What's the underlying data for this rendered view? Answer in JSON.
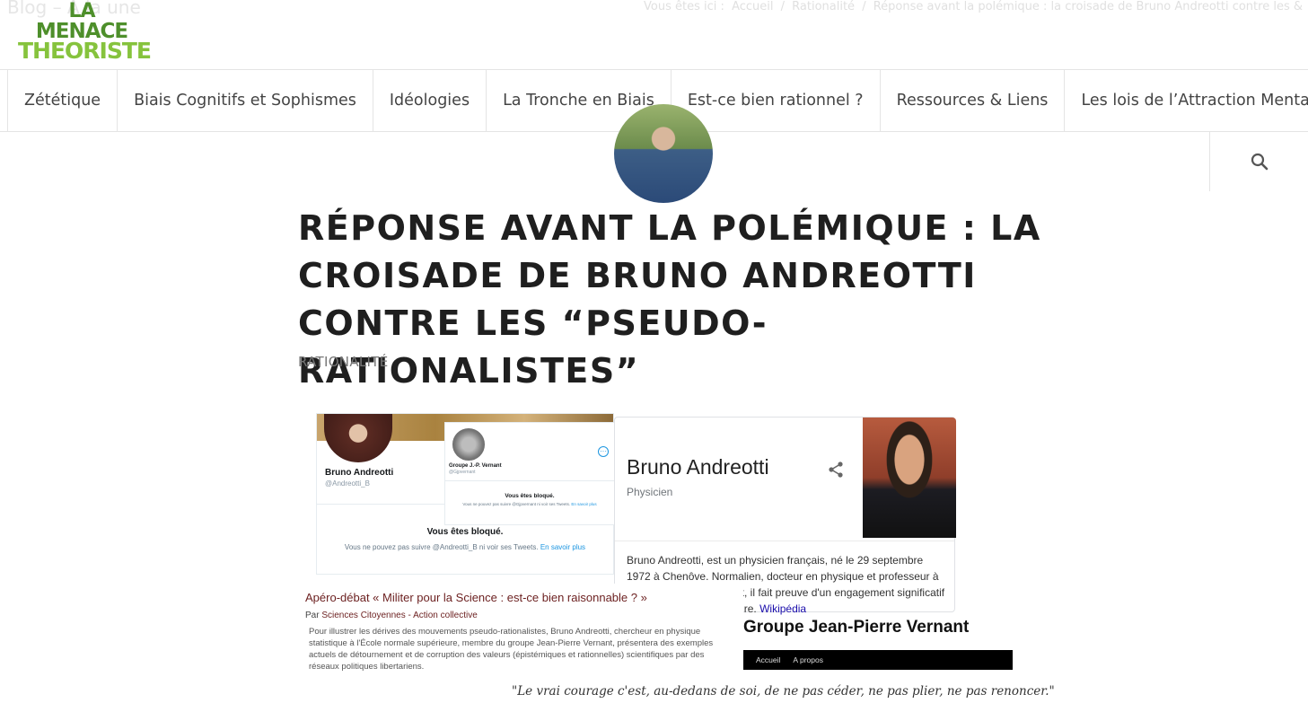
{
  "header": {
    "ghost_title": "Blog – A la une",
    "breadcrumb": {
      "prefix": "Vous êtes ici :",
      "home": "Accueil",
      "sep1": "/",
      "category": "Rationalité",
      "sep2": "/",
      "current": "Réponse avant la polémique : la croisade de Bruno Andreotti contre les &"
    },
    "logo": {
      "line1": "LA",
      "line2": "MENACE",
      "line3": "THEORISTE"
    }
  },
  "nav": {
    "items": [
      {
        "label": "Zététique"
      },
      {
        "label": "Biais Cognitifs et Sophismes"
      },
      {
        "label": "Idéologies"
      },
      {
        "label": "La Tronche en Biais"
      },
      {
        "label": "Est-ce bien rationnel ?"
      },
      {
        "label": "Ressources & Liens"
      },
      {
        "label": "Les lois de l’Attraction Mentale"
      }
    ],
    "search_icon": "search-icon"
  },
  "article": {
    "title": "Réponse avant la polémique : la croisade de Bruno Andreotti contre les “pseudo-rationalistes”",
    "category": "RATIONALITÉ"
  },
  "collage": {
    "tweet1": {
      "name": "Bruno Andreotti",
      "handle": "@Andreotti_B",
      "blocked": "Vous êtes bloqué.",
      "msg": "Vous ne pouvez pas suivre @Andreotti_B ni voir ses Tweets.",
      "link": "En savoir plus"
    },
    "tweet2": {
      "name": "Groupe J.-P. Vernant",
      "handle": "@Gjpvernant",
      "blocked": "Vous êtes bloqué.",
      "msg": "Vous ne pouvez pas suivre @Gjpvernant ni voir ses Tweets.",
      "link": "En savoir plus"
    },
    "knowledge_panel": {
      "name": "Bruno Andreotti",
      "subtitle": "Physicien",
      "description": "Bruno Andreotti, est un physicien français, né le 29 septembre 1972 à Chenôve. Normalien, docteur en physique et professeur à l'Université Paris Diderot, il fait preuve d'un engagement significatif dans le milieu universitaire.",
      "link": "Wikipédia"
    },
    "apero": {
      "title": "Apéro-débat « Militer pour la Science : est-ce bien raisonnable ? »",
      "by_prefix": "Par",
      "org": "Sciences Citoyennes - Action collective",
      "text": "Pour illustrer les dérives des mouvements pseudo-rationalistes, Bruno Andreotti, chercheur en physique statistique à l'École normale supérieure, membre du groupe Jean-Pierre Vernant, présentera des exemples actuels de détournement et de corruption des valeurs (épistémiques et rationnelles) scientifiques par des réseaux politiques libertariens."
    },
    "gjpv": {
      "title": "Groupe Jean-Pierre Vernant",
      "menu_home": "Accueil",
      "menu_about": "A propos"
    },
    "quote": "\"Le vrai courage c'est, au-dedans de soi, de ne pas céder, ne pas plier, ne pas renoncer.\""
  },
  "colors": {
    "logo_dark_green": "#4e8f2b",
    "logo_light_green": "#86c33d",
    "nav_text": "#444444",
    "title_text": "#1f1f1f",
    "twitter_blue": "#1b95e0",
    "google_link": "#1a0dab"
  }
}
